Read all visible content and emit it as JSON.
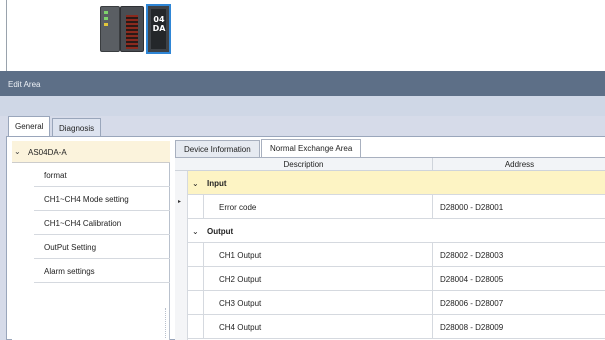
{
  "hardware": {
    "selected_module_text": [
      "04",
      "DA"
    ]
  },
  "edit_area": {
    "title": "Edit Area",
    "outer_tabs": [
      {
        "label": "General",
        "active": true
      },
      {
        "label": "Diagnosis",
        "active": false
      }
    ]
  },
  "tree": {
    "root_label": "AS04DA-A",
    "root_expander": "⌄",
    "items": [
      {
        "label": "format"
      },
      {
        "label": "CH1~CH4 Mode setting"
      },
      {
        "label": "CH1~CH4 Calibration"
      },
      {
        "label": "OutPut Setting"
      },
      {
        "label": "Alarm settings"
      }
    ]
  },
  "inner_tabs": [
    {
      "label": "Device Information",
      "active": false
    },
    {
      "label": "Normal Exchange Area",
      "active": true
    }
  ],
  "grid": {
    "columns": [
      "Description",
      "Address"
    ],
    "current_row_marker": "▸",
    "groups": [
      {
        "title": "Input",
        "expander": "⌄",
        "rows": [
          {
            "description": "Error code",
            "address": "D28000 - D28001"
          }
        ]
      },
      {
        "title": "Output",
        "expander": "⌄",
        "rows": [
          {
            "description": "CH1 Output",
            "address": "D28002 - D28003"
          },
          {
            "description": "CH2 Output",
            "address": "D28004 - D28005"
          },
          {
            "description": "CH3 Output",
            "address": "D28006 - D28007"
          },
          {
            "description": "CH4 Output",
            "address": "D28008 - D28009"
          }
        ]
      }
    ]
  },
  "colors": {
    "title_bar": "#5d6f87",
    "selection_highlight": "#2f86d6",
    "input_group_row": "#fdf4c4",
    "tree_root_row": "#fbf3dc"
  }
}
